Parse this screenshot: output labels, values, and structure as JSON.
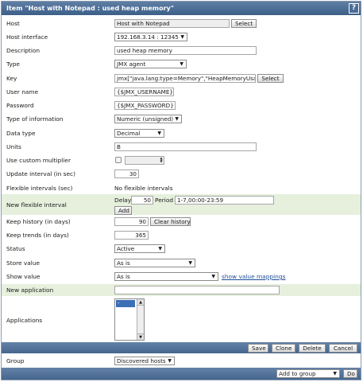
{
  "header": {
    "title": "Item \"Host with Notepad : used heap memory\"",
    "help_glyph": "?"
  },
  "fields": {
    "host": {
      "label": "Host",
      "value": "Host with Notepad",
      "button": "Select"
    },
    "host_interface": {
      "label": "Host interface",
      "value": "192.168.3.14 : 12345"
    },
    "description": {
      "label": "Description",
      "value": "used heap memory"
    },
    "type": {
      "label": "Type",
      "value": "JMX agent"
    },
    "key": {
      "label": "Key",
      "value": "jmx[\"java.lang:type=Memory\",\"HeapMemoryUsage.u",
      "button": "Select"
    },
    "user_name": {
      "label": "User name",
      "value": "{$JMX_USERNAME}"
    },
    "password": {
      "label": "Password",
      "value": "{$JMX_PASSWORD}"
    },
    "type_of_information": {
      "label": "Type of information",
      "value": "Numeric (unsigned)"
    },
    "data_type": {
      "label": "Data type",
      "value": "Decimal"
    },
    "units": {
      "label": "Units",
      "value": "B"
    },
    "custom_multiplier": {
      "label": "Use custom multiplier",
      "checked": false,
      "value": ""
    },
    "update_interval": {
      "label": "Update interval (in sec)",
      "value": "30"
    },
    "flexible_intervals": {
      "label": "Flexible intervals (sec)",
      "value": "No flexible intervals"
    },
    "new_flexible_interval": {
      "label": "New flexible interval",
      "delay_label": "Delay",
      "delay_value": "50",
      "period_label": "Period",
      "period_value": "1-7,00:00-23:59",
      "add_button": "Add"
    },
    "keep_history": {
      "label": "Keep history (in days)",
      "value": "90",
      "button": "Clear history"
    },
    "keep_trends": {
      "label": "Keep trends (in days)",
      "value": "365"
    },
    "status": {
      "label": "Status",
      "value": "Active"
    },
    "store_value": {
      "label": "Store value",
      "value": "As is"
    },
    "show_value": {
      "label": "Show value",
      "value": "As is",
      "link": "show value mappings"
    },
    "new_application": {
      "label": "New application",
      "value": ""
    },
    "applications": {
      "label": "Applications",
      "options": [
        "-None-"
      ],
      "selected": "-None-"
    }
  },
  "actions": {
    "save": "Save",
    "clone": "Clone",
    "delete": "Delete",
    "cancel": "Cancel"
  },
  "group": {
    "label": "Group",
    "value": "Discovered hosts"
  },
  "footer": {
    "action_select": "Add to group",
    "go_button": "Do"
  },
  "colors": {
    "title_bar": "#4a6d97",
    "highlight_row": "#e6f0dd",
    "link": "#1d4d9b"
  }
}
